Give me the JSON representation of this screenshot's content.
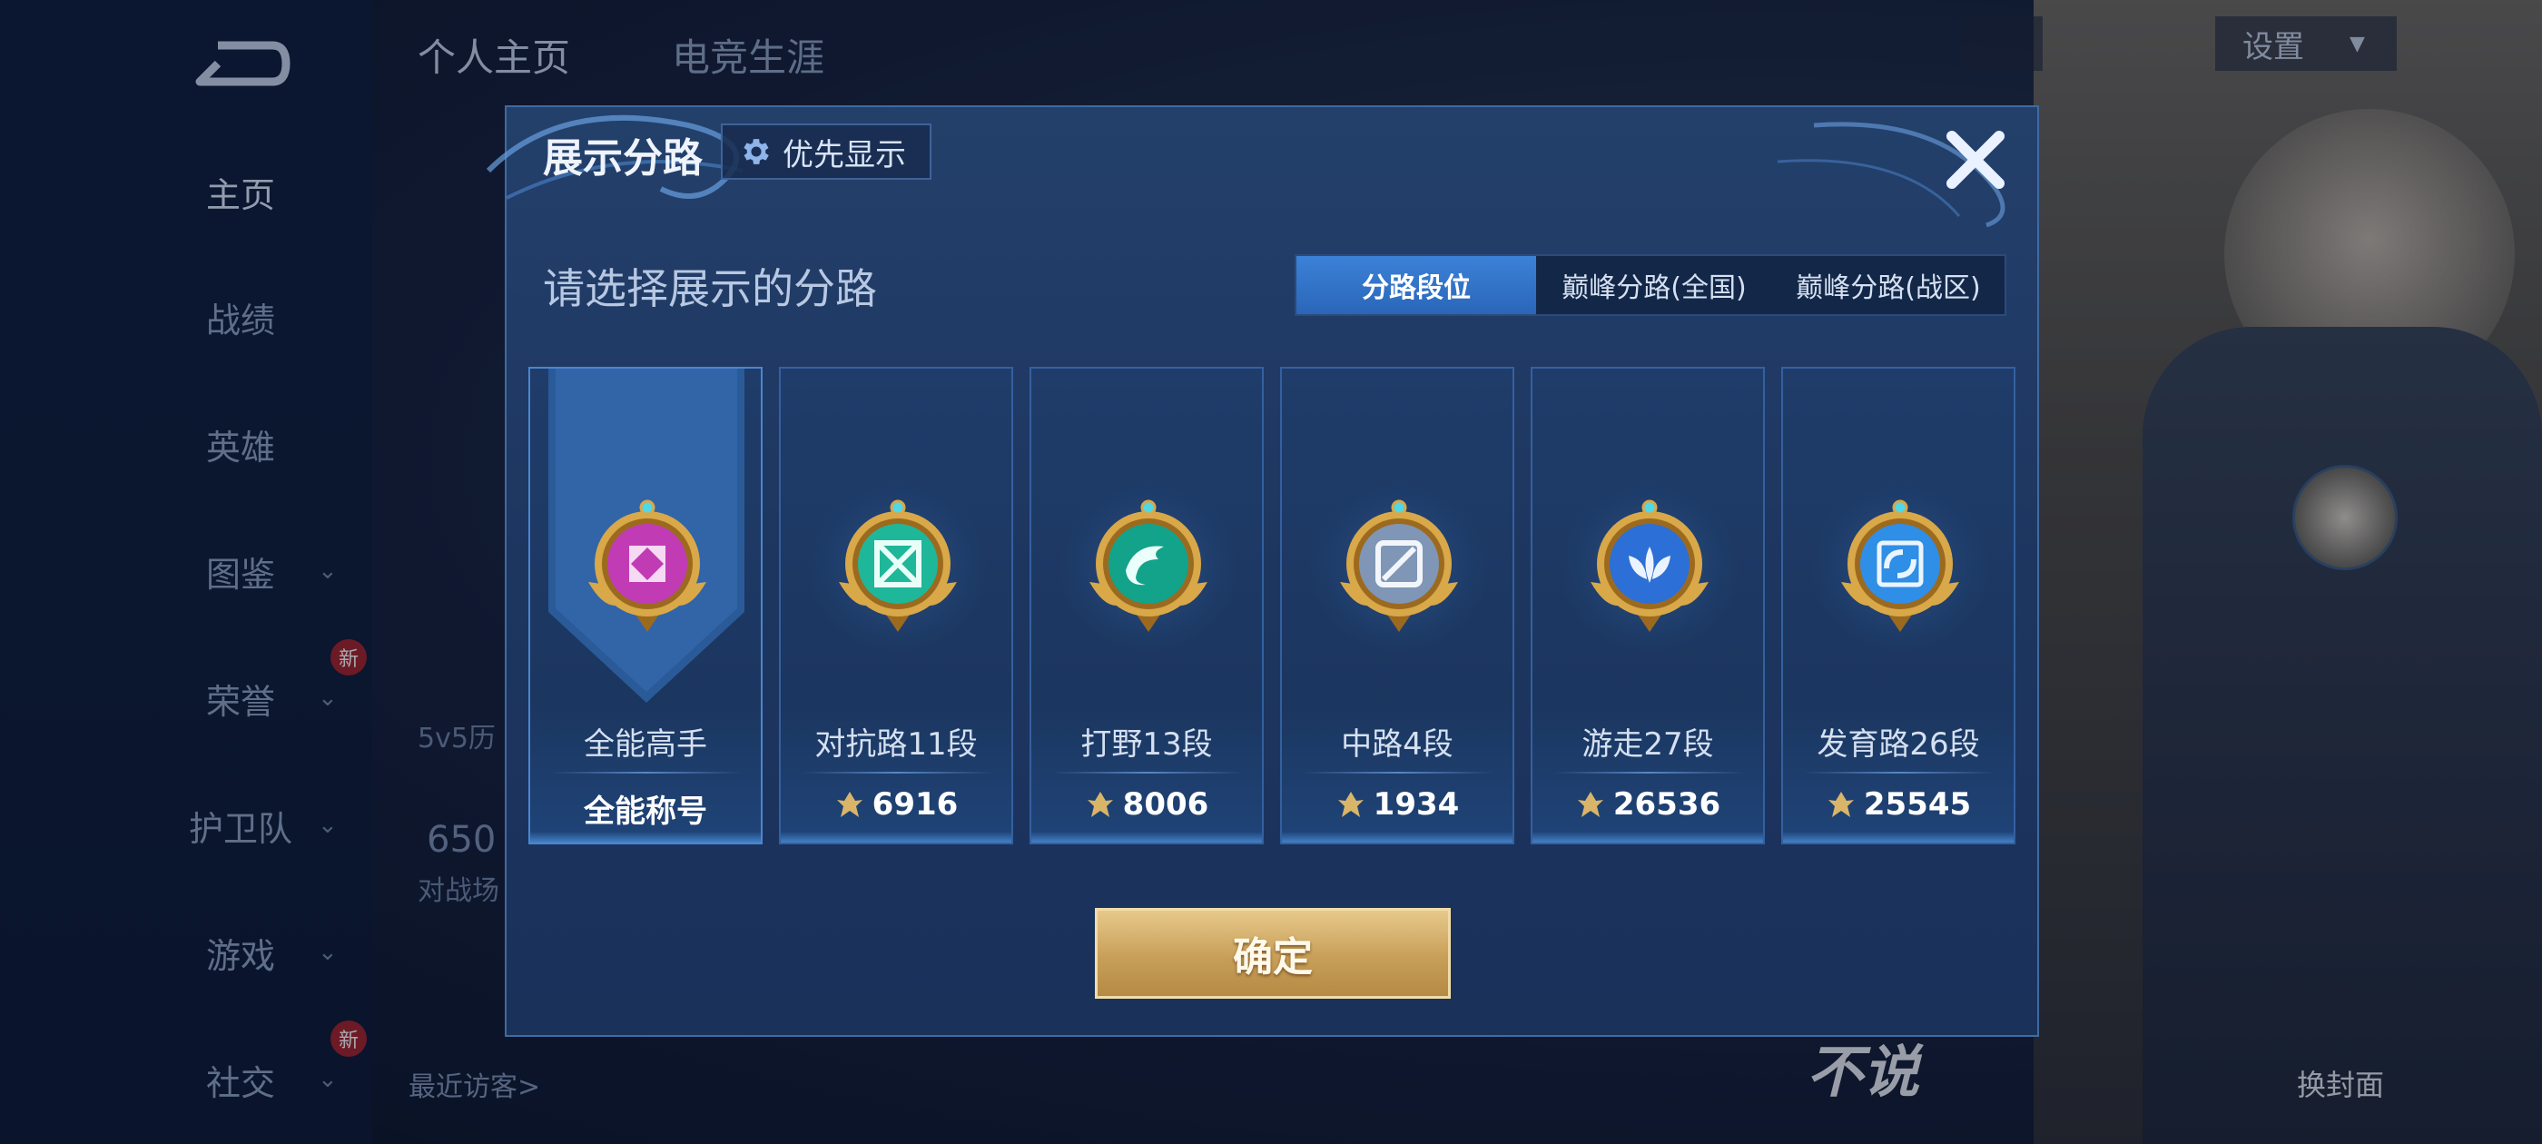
{
  "background": {
    "tabs": [
      "个人主页",
      "电竞生涯"
    ],
    "settings_label": "设置",
    "sidebar": [
      {
        "label": "主页",
        "active": true,
        "chevron": false,
        "new": false
      },
      {
        "label": "战绩",
        "active": false,
        "chevron": false,
        "new": false
      },
      {
        "label": "英雄",
        "active": false,
        "chevron": false,
        "new": false
      },
      {
        "label": "图鉴",
        "active": false,
        "chevron": true,
        "new": false
      },
      {
        "label": "荣誉",
        "active": false,
        "chevron": true,
        "new": true
      },
      {
        "label": "护卫队",
        "active": false,
        "chevron": true,
        "new": false
      },
      {
        "label": "游戏",
        "active": false,
        "chevron": true,
        "new": false
      },
      {
        "label": "社交",
        "active": false,
        "chevron": true,
        "new": true
      }
    ],
    "new_badge": "新",
    "recent_visitors": "最近访客>",
    "change_cover": "换封面",
    "partial_left_text": "5v5历",
    "partial_left_number": "650",
    "partial_left_sub": "对战场",
    "brand_text": "不说"
  },
  "modal": {
    "title": "展示分路",
    "priority_label": "优先显示",
    "subtitle": "请选择展示的分路",
    "tabs": [
      {
        "label": "分路段位",
        "active": true
      },
      {
        "label": "巅峰分路(全国)",
        "active": false
      },
      {
        "label": "巅峰分路(战区)",
        "active": false
      }
    ],
    "cards": [
      {
        "name": "全能高手",
        "score": "全能称号",
        "selected": true,
        "emblem": "all-round-emblem-icon",
        "color": "#c13bb5"
      },
      {
        "name": "对抗路11段",
        "score": "6916",
        "selected": false,
        "emblem": "clash-lane-emblem-icon",
        "color": "#1fb79a"
      },
      {
        "name": "打野13段",
        "score": "8006",
        "selected": false,
        "emblem": "jungle-emblem-icon",
        "color": "#12a38a"
      },
      {
        "name": "中路4段",
        "score": "1934",
        "selected": false,
        "emblem": "mid-lane-emblem-icon",
        "color": "#7f96b6"
      },
      {
        "name": "游走27段",
        "score": "26536",
        "selected": false,
        "emblem": "roam-emblem-icon",
        "color": "#2c6fd6"
      },
      {
        "name": "发育路26段",
        "score": "25545",
        "selected": false,
        "emblem": "farm-lane-emblem-icon",
        "color": "#2f8ee6"
      }
    ],
    "confirm_label": "确定"
  }
}
